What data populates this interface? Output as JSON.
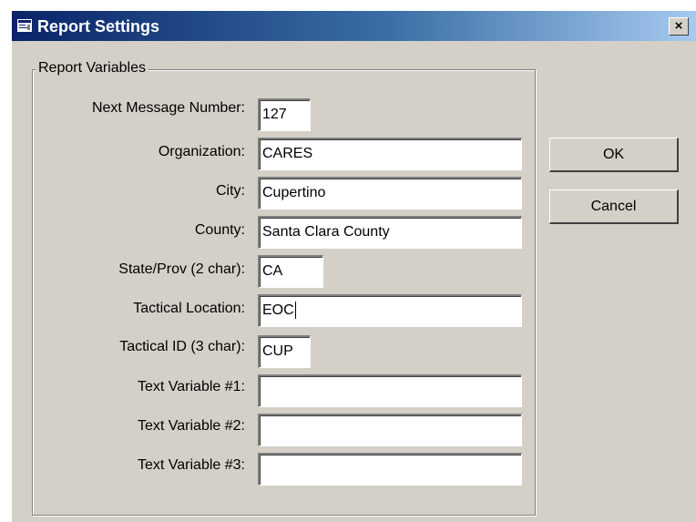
{
  "window": {
    "title": "Report Settings",
    "close_label": "×"
  },
  "group": {
    "legend": "Report Variables"
  },
  "fields": [
    {
      "label": "Next Message Number:",
      "value": "127"
    },
    {
      "label": "Organization:",
      "value": "CARES"
    },
    {
      "label": "City:",
      "value": "Cupertino"
    },
    {
      "label": "County:",
      "value": "Santa Clara County"
    },
    {
      "label": "State/Prov (2 char):",
      "value": "CA"
    },
    {
      "label": "Tactical Location:",
      "value": "EOC"
    },
    {
      "label": "Tactical ID (3 char):",
      "value": "CUP"
    },
    {
      "label": "Text Variable #1:",
      "value": ""
    },
    {
      "label": "Text Variable #2:",
      "value": ""
    },
    {
      "label": "Text Variable #3:",
      "value": ""
    }
  ],
  "buttons": {
    "ok": "OK",
    "cancel": "Cancel"
  }
}
